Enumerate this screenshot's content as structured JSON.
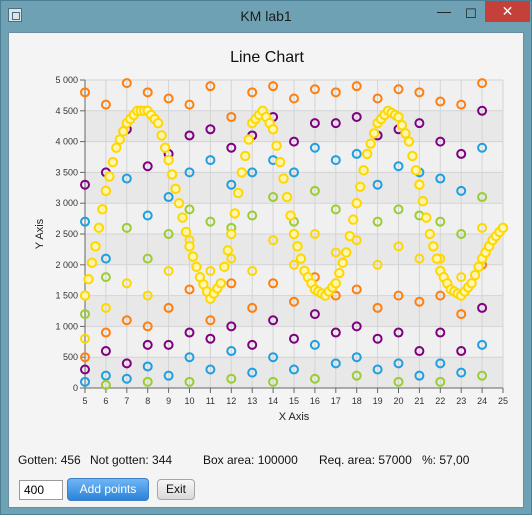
{
  "window": {
    "title": "KM lab1",
    "min_glyph": "—",
    "max_glyph": "☐",
    "close_glyph": "✕"
  },
  "stats": {
    "gotten": "Gotten: 456",
    "not_gotten": "Not gotten: 344",
    "box_area": "Box area: 100000",
    "req_area": "Req. area: 57000",
    "percent": "%: 57,00"
  },
  "controls": {
    "points_value": "400",
    "add_label": "Add points",
    "exit_label": "Exit"
  },
  "colors": {
    "accent": "#2b82d8",
    "curve": "#ffd700",
    "series": [
      "#ff7f0e",
      "#800080",
      "#1f9fe0",
      "#9acd32",
      "#ffd700"
    ]
  },
  "chart_data": {
    "type": "scatter",
    "title": "Line Chart",
    "xlabel": "X Axis",
    "ylabel": "Y Axis",
    "xlim": [
      5,
      25
    ],
    "ylim": [
      0,
      5000
    ],
    "x_ticks": [
      "5",
      "6",
      "7",
      "8",
      "9",
      "10",
      "11",
      "12",
      "13",
      "14",
      "15",
      "16",
      "17",
      "18",
      "19",
      "20",
      "21",
      "22",
      "23",
      "24",
      "25"
    ],
    "y_ticks": [
      "0",
      "500",
      "1 000",
      "1 500",
      "2 000",
      "2 500",
      "3 000",
      "3 500",
      "4 000",
      "4 500",
      "5 000"
    ],
    "grid": true,
    "legend": "none",
    "curve": {
      "description": "dense yellow circles forming a wave",
      "x": [
        5,
        5.5,
        6,
        6.5,
        7,
        7.5,
        8,
        8.5,
        9,
        9.5,
        10,
        10.5,
        11,
        11.5,
        12,
        12.5,
        13,
        13.5,
        14,
        14.5,
        15,
        15.5,
        16,
        16.5,
        17,
        17.5,
        18,
        18.5,
        19,
        19.5,
        20,
        20.5,
        21,
        21.5,
        22,
        22.5,
        23,
        23.5,
        24,
        24.5,
        25
      ],
      "y": [
        1500,
        2300,
        3200,
        3900,
        4300,
        4500,
        4500,
        4300,
        3700,
        3000,
        2300,
        1800,
        1450,
        1700,
        2500,
        3500,
        4300,
        4500,
        4200,
        3400,
        2500,
        1900,
        1600,
        1500,
        1700,
        2200,
        3000,
        3800,
        4300,
        4500,
        4400,
        4000,
        3300,
        2500,
        1900,
        1600,
        1500,
        1700,
        2100,
        2400,
        2600
      ]
    },
    "scatter_points": {
      "x": [
        5,
        5,
        5,
        5,
        5,
        5,
        5,
        5,
        6,
        6,
        6,
        6,
        6,
        6,
        6,
        6,
        6,
        7,
        7,
        7,
        7,
        7,
        7,
        7,
        7,
        8,
        8,
        8,
        8,
        8,
        8,
        8,
        8,
        8,
        9,
        9,
        9,
        9,
        9,
        9,
        9,
        9,
        10,
        10,
        10,
        10,
        10,
        10,
        10,
        10,
        10,
        11,
        11,
        11,
        11,
        11,
        11,
        11,
        11,
        12,
        12,
        12,
        12,
        12,
        12,
        12,
        12,
        12,
        13,
        13,
        13,
        13,
        13,
        13,
        13,
        13,
        14,
        14,
        14,
        14,
        14,
        14,
        14,
        14,
        14,
        15,
        15,
        15,
        15,
        15,
        15,
        15,
        15,
        16,
        16,
        16,
        16,
        16,
        16,
        16,
        16,
        16,
        17,
        17,
        17,
        17,
        17,
        17,
        17,
        17,
        18,
        18,
        18,
        18,
        18,
        18,
        18,
        18,
        18,
        19,
        19,
        19,
        19,
        19,
        19,
        19,
        19,
        20,
        20,
        20,
        20,
        20,
        20,
        20,
        20,
        20,
        21,
        21,
        21,
        21,
        21,
        21,
        21,
        21,
        22,
        22,
        22,
        22,
        22,
        22,
        22,
        22,
        22,
        23,
        23,
        23,
        23,
        23,
        23,
        23,
        23,
        24,
        24,
        24,
        24,
        24,
        24,
        24,
        24,
        24
      ],
      "y": [
        4800,
        3300,
        2700,
        1200,
        800,
        500,
        300,
        100,
        4600,
        3500,
        2100,
        1800,
        1300,
        900,
        600,
        200,
        50,
        4950,
        4200,
        3400,
        2600,
        1700,
        1100,
        400,
        150,
        4800,
        3600,
        2800,
        2100,
        1500,
        1000,
        700,
        350,
        100,
        4700,
        3800,
        3100,
        2500,
        1900,
        1300,
        700,
        200,
        4600,
        4100,
        3500,
        2900,
        2400,
        1600,
        900,
        500,
        100,
        4900,
        4200,
        3700,
        2700,
        1900,
        1100,
        800,
        300,
        4400,
        3900,
        3300,
        2600,
        2100,
        1700,
        1000,
        600,
        150,
        4800,
        4100,
        3500,
        2800,
        1900,
        1300,
        700,
        250,
        4900,
        4400,
        3700,
        3100,
        2400,
        1700,
        1100,
        500,
        100,
        4700,
        4000,
        3500,
        2700,
        2000,
        1400,
        800,
        300,
        4850,
        4300,
        3900,
        3200,
        2500,
        1800,
        1200,
        700,
        150,
        4800,
        4300,
        3700,
        2900,
        2200,
        1500,
        900,
        400,
        4900,
        4400,
        3800,
        3000,
        2400,
        1600,
        1000,
        500,
        200,
        4700,
        4100,
        3300,
        2700,
        2000,
        1300,
        800,
        300,
        4850,
        4200,
        3600,
        2900,
        2300,
        1500,
        900,
        400,
        100,
        4800,
        4300,
        3500,
        2800,
        2100,
        1400,
        600,
        200,
        4650,
        4000,
        3400,
        2700,
        2100,
        1500,
        900,
        400,
        100,
        4600,
        3800,
        3200,
        2500,
        1800,
        1200,
        600,
        250,
        4950,
        4500,
        3900,
        3100,
        2600,
        2000,
        1300,
        700,
        200
      ],
      "series": [
        0,
        1,
        2,
        3,
        4,
        0,
        1,
        2,
        0,
        1,
        2,
        3,
        4,
        0,
        1,
        2,
        3,
        0,
        1,
        2,
        3,
        4,
        0,
        1,
        2,
        0,
        1,
        2,
        3,
        4,
        0,
        1,
        2,
        3,
        0,
        1,
        2,
        3,
        4,
        0,
        1,
        2,
        0,
        1,
        2,
        3,
        4,
        0,
        1,
        2,
        3,
        0,
        1,
        2,
        3,
        4,
        0,
        1,
        2,
        0,
        1,
        2,
        3,
        4,
        0,
        1,
        2,
        3,
        0,
        1,
        2,
        3,
        4,
        0,
        1,
        2,
        0,
        1,
        2,
        3,
        4,
        0,
        1,
        2,
        3,
        0,
        1,
        2,
        3,
        4,
        0,
        1,
        2,
        0,
        1,
        2,
        3,
        4,
        0,
        1,
        2,
        3,
        0,
        1,
        2,
        3,
        4,
        0,
        1,
        2,
        0,
        1,
        2,
        3,
        4,
        0,
        1,
        2,
        3,
        0,
        1,
        2,
        3,
        4,
        0,
        1,
        2,
        0,
        1,
        2,
        3,
        4,
        0,
        1,
        2,
        3,
        0,
        1,
        2,
        3,
        4,
        0,
        1,
        2,
        0,
        1,
        2,
        3,
        4,
        0,
        1,
        2,
        3,
        0,
        1,
        2,
        3,
        4,
        0,
        1,
        2,
        0,
        1,
        2,
        3,
        4,
        0,
        1,
        2,
        3
      ]
    }
  }
}
